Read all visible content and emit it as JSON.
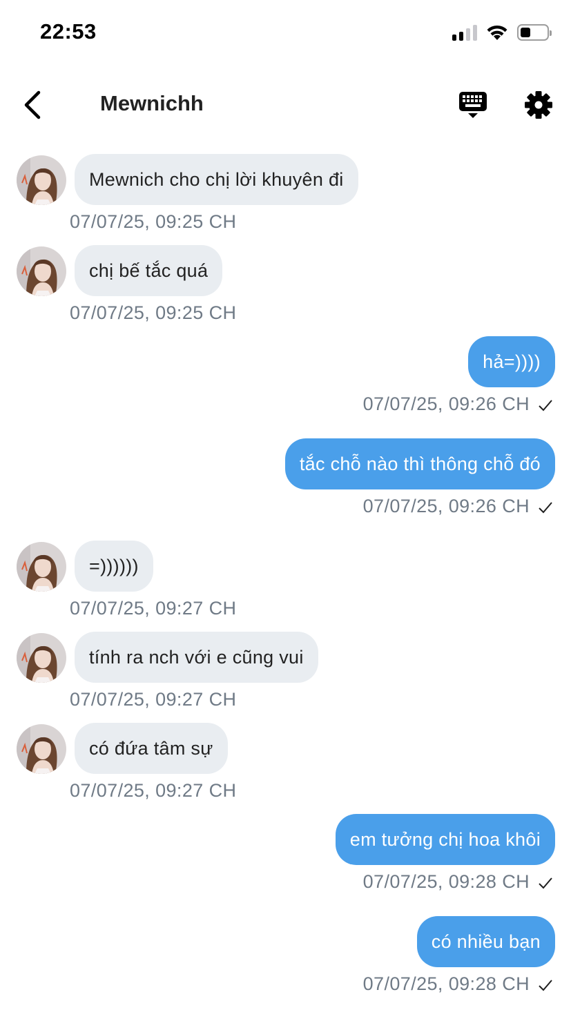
{
  "status_bar": {
    "time": "22:53",
    "icons": [
      "cellular-signal-icon",
      "wifi-icon",
      "battery-icon"
    ],
    "battery_level": 0.4
  },
  "header": {
    "back_icon": "chevron-left-icon",
    "title": "Mewnichh",
    "keyboard_icon": "keyboard-icon",
    "settings_icon": "gear-icon"
  },
  "colors": {
    "incoming_bubble": "#e9edf1",
    "outgoing_bubble": "#4a9fea",
    "timestamp": "#6f7a86"
  },
  "messages": [
    {
      "direction": "in",
      "text": "Mewnich cho chị lời khuyên đi",
      "time": "07/07/25, 09:25 CH"
    },
    {
      "direction": "in",
      "text": "chị bế tắc quá",
      "time": "07/07/25, 09:25 CH"
    },
    {
      "direction": "out",
      "text": "hả=))))",
      "time": "07/07/25, 09:26 CH",
      "status_icon": "checkmark-icon"
    },
    {
      "direction": "out",
      "text": "tắc chỗ nào thì thông chỗ đó",
      "time": "07/07/25, 09:26 CH",
      "status_icon": "checkmark-icon"
    },
    {
      "direction": "in",
      "text": "=))))))",
      "time": "07/07/25, 09:27 CH"
    },
    {
      "direction": "in",
      "text": "tính ra nch với e cũng vui",
      "time": "07/07/25, 09:27 CH"
    },
    {
      "direction": "in",
      "text": "có đứa tâm sự",
      "time": "07/07/25, 09:27 CH"
    },
    {
      "direction": "out",
      "text": "em tưởng chị hoa khôi",
      "time": "07/07/25, 09:28 CH",
      "status_icon": "checkmark-icon"
    },
    {
      "direction": "out",
      "text": "có nhiều bạn",
      "time": "07/07/25, 09:28 CH",
      "status_icon": "checkmark-icon"
    }
  ]
}
